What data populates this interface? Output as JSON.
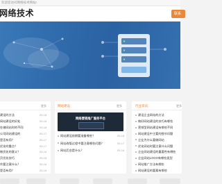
{
  "topbar": {
    "text": "欢迎您访问网络技术网站!"
  },
  "header": {
    "logo": "网络技术",
    "action_button": "联系"
  },
  "banner": {
    "theme_color": "#2f6aab"
  },
  "left_panel": {
    "more": "更多",
    "items": [
      {
        "title": "建设的方法",
        "date": "05-18"
      },
      {
        "title": "网站建设的好处",
        "date": "05-18"
      },
      {
        "title": "在做网站时的不同",
        "date": "05-18"
      },
      {
        "title": "公司网站建设的",
        "date": "05-17"
      },
      {
        "title": "是否有用？",
        "date": "05-17"
      },
      {
        "title": "优化的重点？",
        "date": "05-17"
      },
      {
        "title": "做优化的意义？",
        "date": "05-16"
      },
      {
        "title": "页优化技巧",
        "date": "05-16"
      },
      {
        "title": "作要注意什么？",
        "date": "05-16"
      },
      {
        "title": "是否有用？",
        "date": "05-15"
      }
    ]
  },
  "middle_panel": {
    "title": "网站建设",
    "more": "更多",
    "image_caption": "网络营销推广服务平台",
    "items": [
      {
        "title": "网站建设前期要准备哪些？",
        "date": "05-18"
      },
      {
        "title": "网站改版过程中要注意哪些问题？",
        "date": "05-17"
      },
      {
        "title": "网站后台是什么？",
        "date": "05-16"
      }
    ]
  },
  "right_panel": {
    "title": "行业资讯",
    "more": "更多",
    "items": [
      {
        "title": "建设企业网站的方法"
      },
      {
        "title": "做好网站建设的技巧有哪些"
      },
      {
        "title": "营销型网站建设有哪些不同"
      },
      {
        "title": "网站建设中主要的细节问题"
      },
      {
        "title": "企业为什么要做网站"
      },
      {
        "title": "优化网站时要注意什么问题"
      },
      {
        "title": "企业网站建设的重要性有哪些"
      },
      {
        "title": "企业网站LOGO有哪些类型"
      },
      {
        "title": "网站推广方法有哪些"
      },
      {
        "title": "网站建设的要素有哪些"
      }
    ]
  }
}
